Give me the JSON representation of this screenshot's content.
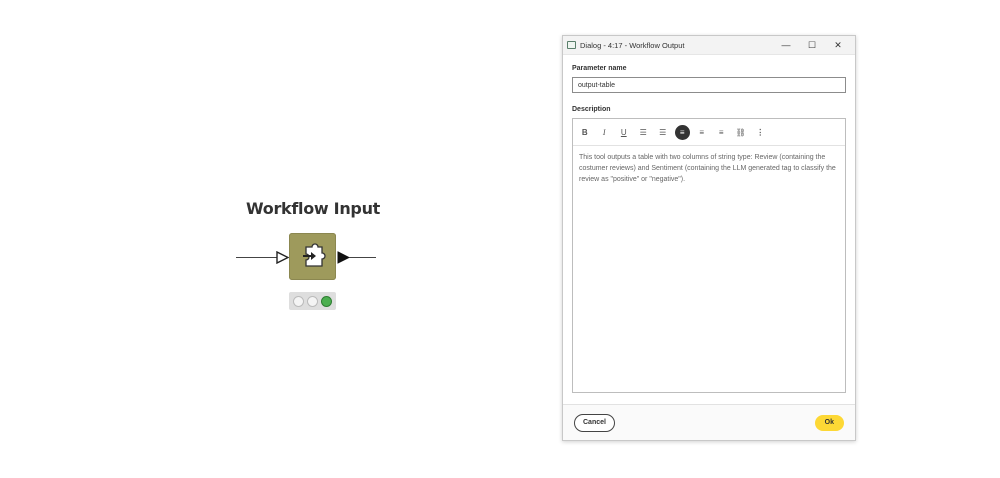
{
  "canvas": {
    "node_title": "Workflow Input",
    "node_color": "#9e9a5c",
    "node_icon": "workflow-input-icon",
    "status_lights": [
      "off",
      "off",
      "green"
    ]
  },
  "dialog": {
    "title": "Dialog - 4:17 - Workflow Output",
    "minimize_glyph": "—",
    "maximize_glyph": "☐",
    "close_glyph": "✕",
    "param_label": "Parameter name",
    "param_value": "output-table",
    "description_label": "Description",
    "toolbar": {
      "bold": "B",
      "italic": "I",
      "underline": "U",
      "bullet_list": "☰",
      "numbered_list": "☰",
      "align_left": "≡",
      "align_center": "≡",
      "align_right": "≡",
      "link": "⛓",
      "more": "⋮"
    },
    "description_text": "This tool outputs a table with two columns of string type: Review (containing the costumer reviews) and Sentiment (containing the LLM generated tag to classify the review as \"positive\" or \"negative\").",
    "cancel_label": "Cancel",
    "ok_label": "Ok",
    "ok_color": "#fdd835"
  }
}
